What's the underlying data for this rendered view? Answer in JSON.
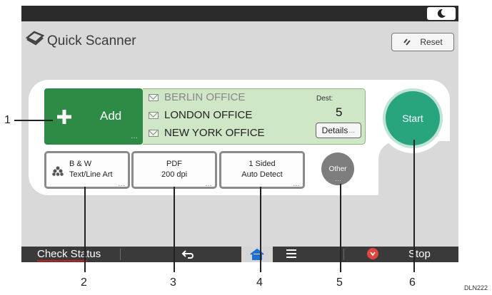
{
  "app": {
    "title": "Quick Scanner",
    "reset_label": "Reset"
  },
  "scan": {
    "add_label": "Add",
    "destinations": [
      "BERLIN OFFICE",
      "LONDON OFFICE",
      "NEW YORK OFFICE"
    ],
    "dest_label": "Dest:",
    "dest_count": "5",
    "details_label": "Details",
    "start_label": "Start"
  },
  "settings": {
    "color": {
      "line1": "B & W",
      "line2": "Text/Line Art"
    },
    "format": {
      "line1": "PDF",
      "line2": "200 dpi"
    },
    "sides": {
      "line1": "1 Sided",
      "line2": "Auto Detect"
    },
    "other_label": "Other"
  },
  "bottom_bar": {
    "check_status": "Check Status",
    "stop": "Stop"
  },
  "callouts": [
    "1",
    "2",
    "3",
    "4",
    "5",
    "6"
  ],
  "document_code": "DLN222",
  "colors": {
    "add": "#2d8b45",
    "start": "#28a47e",
    "dest_bg": "#cfe6c7"
  }
}
